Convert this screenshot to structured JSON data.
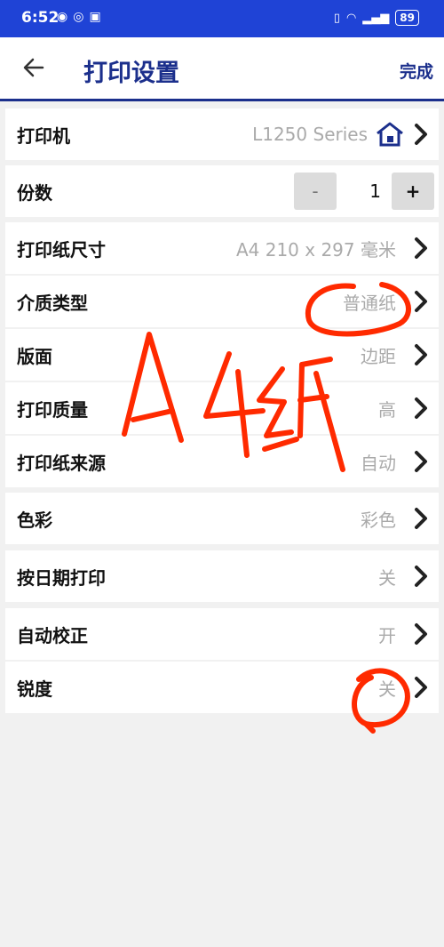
{
  "status_bar": {
    "time": "6:52",
    "left_icons": [
      "location-icon",
      "eye-icon",
      "nfc-icon"
    ],
    "right_icons": [
      "vibrate-icon",
      "wifi-icon",
      "signal-icon"
    ],
    "battery": "89"
  },
  "header": {
    "title": "打印设置",
    "done_label": "完成"
  },
  "rows": {
    "printer": {
      "label": "打印机",
      "value": "L1250 Series"
    },
    "copies": {
      "label": "份数",
      "minus": "-",
      "value": "1",
      "plus": "+"
    },
    "paper_size": {
      "label": "打印纸尺寸",
      "value": "A4 210 x 297 毫米"
    },
    "media_type": {
      "label": "介质类型",
      "value": "普通纸"
    },
    "layout": {
      "label": "版面",
      "value": "边距"
    },
    "quality": {
      "label": "打印质量",
      "value": "高"
    },
    "paper_source": {
      "label": "打印纸来源",
      "value": "自动"
    },
    "color": {
      "label": "色彩",
      "value": "彩色"
    },
    "date_print": {
      "label": "按日期打印",
      "value": "关"
    },
    "auto_correct": {
      "label": "自动校正",
      "value": "开"
    },
    "sharpness": {
      "label": "锐度",
      "value": "关"
    }
  },
  "annotation": {
    "handwriting": "A4纸",
    "color": "#ff2a00"
  },
  "colors": {
    "status_bar": "#1f43d6",
    "title": "#1b2f8c",
    "background": "#f1f1f1"
  }
}
